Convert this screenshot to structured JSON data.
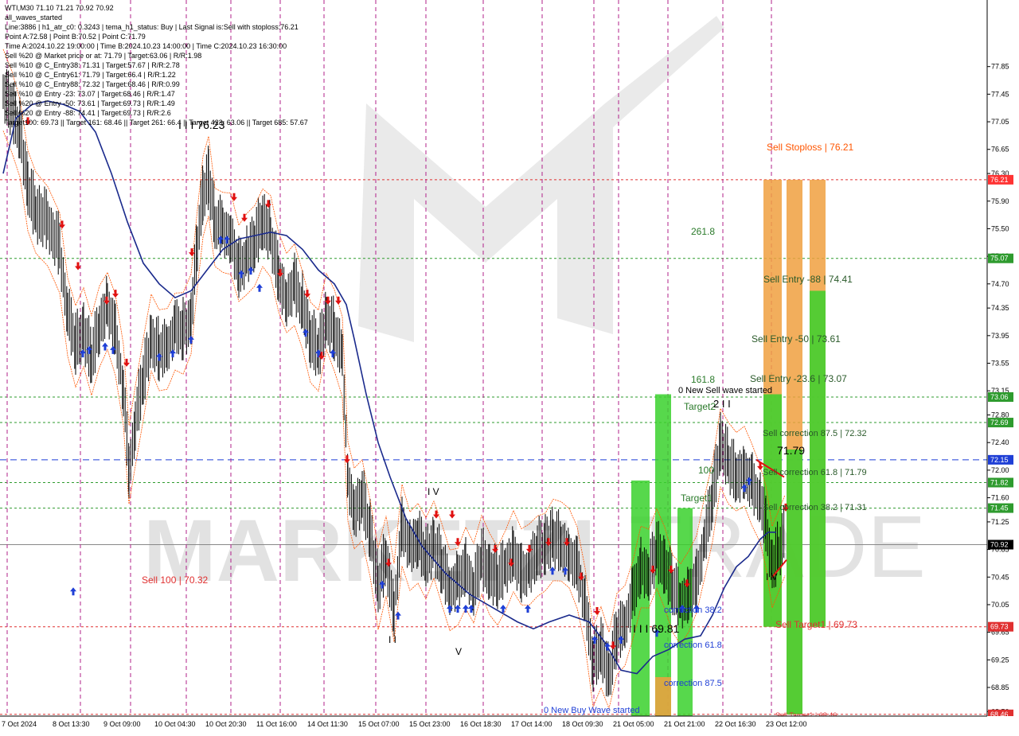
{
  "header": {
    "symbol_line": "WTI,M30  71.10 71.21 70.92 70.92",
    "lines": [
      "all_waves_started",
      "Line:3886 | h1_atr_c0: 0.3243 | tema_h1_status: Buy | Last Signal is:Sell with stoploss:76.21",
      "Point A:72.58 | Point B:70.52 | Point C:71.79",
      "Time A:2024.10.22 19:00:00 | Time B:2024.10.23 14:00:00 | Time C:2024.10.23 16:30:00",
      "Sell %20 @ Market price or at: 71.79 | Target:63.06 | R/R:1.98",
      "Sell %10 @ C_Entry38: 71.31 | Target:57.67 | R/R:2.78",
      "Sell %10 @ C_Entry61: 71.79 | Target:66.4 | R/R:1.22",
      "Sell %10 @ C_Entry88: 72.32 | Target:68.46 | R/R:0.99",
      "Sell %10 @ Entry -23: 73.07 | Target:68.46 | R/R:1.47",
      "Sell %20 @ Entry -50: 73.61 | Target:69.73 | R/R:1.49",
      "Sell %20 @ Entry -88: 74.41 | Target:69.73 | R/R:2.6",
      "Target100: 69.73 || Target 161: 68.46 || Target 261: 66.4 || Target 423: 63.06 || Target 685: 57.67"
    ]
  },
  "price_axis": {
    "ticks": [
      "77.85",
      "77.45",
      "77.05",
      "76.65",
      "76.30",
      "75.90",
      "75.50",
      "75.10",
      "74.70",
      "74.35",
      "73.95",
      "73.55",
      "73.15",
      "72.80",
      "72.40",
      "72.00",
      "71.60",
      "71.25",
      "70.85",
      "70.45",
      "70.05",
      "69.65",
      "69.25",
      "68.85",
      "68.50"
    ],
    "markers": [
      {
        "label": "76.21",
        "color": "#ff3333"
      },
      {
        "label": "75.07",
        "color": "#2e9b2e"
      },
      {
        "label": "73.06",
        "color": "#2e9b2e"
      },
      {
        "label": "72.69",
        "color": "#2e9b2e"
      },
      {
        "label": "72.15",
        "color": "#1f3fd6"
      },
      {
        "label": "71.82",
        "color": "#2e9b2e"
      },
      {
        "label": "71.45",
        "color": "#2e9b2e"
      },
      {
        "label": "70.92",
        "color": "#000000"
      },
      {
        "label": "69.73",
        "color": "#e03030"
      },
      {
        "label": "68.46",
        "color": "#e03030"
      }
    ]
  },
  "time_axis": [
    "7 Oct 2024",
    "8 Oct 13:30",
    "9 Oct 09:00",
    "10 Oct 04:30",
    "10 Oct 20:30",
    "11 Oct 16:00",
    "14 Oct 11:30",
    "15 Oct 07:00",
    "15 Oct 23:00",
    "16 Oct 18:30",
    "17 Oct 14:00",
    "18 Oct 09:30",
    "21 Oct 05:00",
    "21 Oct 21:00",
    "22 Oct 16:30",
    "23 Oct 12:00"
  ],
  "annotations": {
    "sell_stoploss": "Sell Stoploss | 76.21",
    "sell_entry_88": "Sell Entry -88 | 74.41",
    "sell_entry_50": "Sell Entry -50 | 73.61",
    "sell_entry_23": "Sell Entry -23.6 | 73.07",
    "sell_corr_875": "Sell correction 87.5 | 72.32",
    "sell_corr_618": "Sell correction 61.8 | 71.79",
    "sell_corr_382": "Sell correction 38.2 | 71.31",
    "sell_target": "Sell Target1 | 69.73",
    "sell_100": "Sell 100 | 70.32",
    "lvl_2618": "261.8",
    "lvl_1618": "161.8",
    "lvl_100": "100",
    "new_sell_wave": "0 New Sell wave started",
    "target2": "Target2",
    "target1": "Target1",
    "corr_382": "correction 38.2",
    "corr_618": "correction 61.8",
    "corr_875": "correction 87.5",
    "new_buy_wave": "0 New Buy Wave started",
    "wave_label_1": "I I I 76.23",
    "wave_label_2": "I I I 69.81",
    "wave_label_3": "2 I I",
    "wave_label_4": "71.79",
    "wave_label_5": "I V",
    "wave_label_6": "I I",
    "wave_label_7": "V",
    "wave_label_8": "I V",
    "bottom_tag": "Sell Target1 | 68.46"
  },
  "watermark": {
    "text_left": "MARKETZI",
    "text_right": "TRADE"
  },
  "colors": {
    "background": "#ffffff",
    "ma_line": "#1a2a8c",
    "candles": "#000000",
    "envelope": "#ff5500",
    "green_zone": "#39d12d",
    "orange_zone": "#f0a040",
    "blue_dashed": "#1f3fd6",
    "grid_green": "#2e9b2e",
    "grid_red": "#e03030",
    "separator": "#b0208a",
    "up_arrow": "#1f3fd6",
    "down_arrow": "#e01010"
  }
}
